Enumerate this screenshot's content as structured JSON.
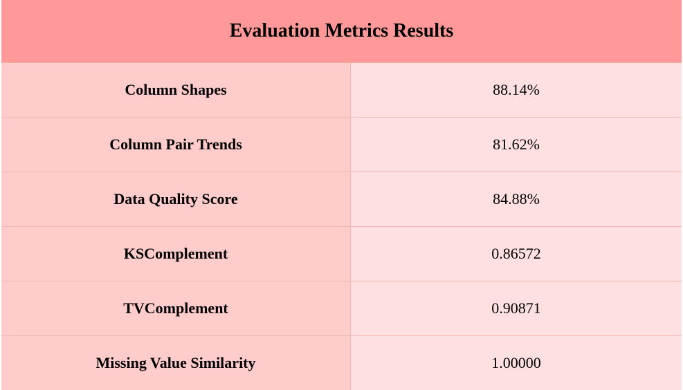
{
  "table": {
    "title": "Evaluation Metrics Results",
    "rows": [
      {
        "label": "Column Shapes",
        "value": "88.14%"
      },
      {
        "label": "Column Pair Trends",
        "value": "81.62%"
      },
      {
        "label": "Data Quality Score",
        "value": "84.88%"
      },
      {
        "label": "KSComplement",
        "value": "0.86572"
      },
      {
        "label": "TVComplement",
        "value": "0.90871"
      },
      {
        "label": "Missing Value Similarity",
        "value": "1.00000"
      }
    ]
  },
  "colors": {
    "header_bg": "#ff9999",
    "label_bg": "#ffcccc",
    "value_bg": "#ffe0e0",
    "border": "#f4b6ae"
  }
}
